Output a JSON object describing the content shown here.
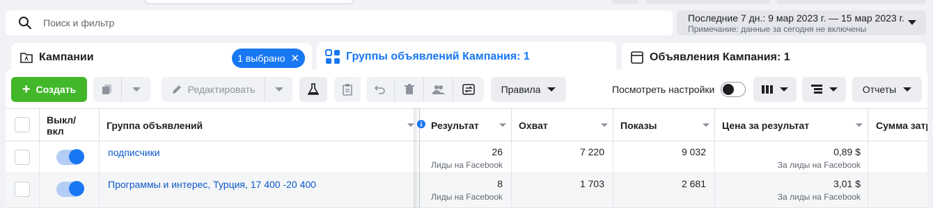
{
  "search": {
    "placeholder": "Поиск и фильтр"
  },
  "daterange": {
    "line1": "Последние 7 дн.: 9 мар 2023 г. — 15 мар 2023 г.",
    "line2": "Примечание: данные за сегодня не включены"
  },
  "tabs": {
    "campaigns": {
      "label": "Кампании",
      "badge": "1 выбрано",
      "badge_close": "✕"
    },
    "adsets": {
      "label": "Группы объявлений Кампания: 1"
    },
    "ads": {
      "label": "Объявления Кампания: 1"
    }
  },
  "toolbar": {
    "create_label": "Создать",
    "create_plus": "+",
    "edit_label": "Редактировать",
    "rules_label": "Правила",
    "view_settings_label": "Посмотреть настройки",
    "reports_label": "Отчеты"
  },
  "table": {
    "headers": {
      "onoff": "Выкл/\nвкл",
      "onoff_line1": "Выкл/",
      "onoff_line2": "вкл",
      "name": "Группа объявлений",
      "results": "Результат",
      "reach": "Охват",
      "impressions": "Показы",
      "cost": "Цена за результат",
      "spend": "Сумма затр"
    },
    "rows": [
      {
        "name": "подписчики",
        "results": "26",
        "results_sub": "Лиды на Facebook",
        "reach": "7 220",
        "impressions": "9 032",
        "cost": "0,89 $",
        "cost_sub": "За лиды на Facebook"
      },
      {
        "name": "Программы и интерес, Турция, 17 400 -20 400",
        "results": "8",
        "results_sub": "Лиды на Facebook",
        "reach": "1 703",
        "impressions": "2 681",
        "cost": "3,01 $",
        "cost_sub": "За лиды на Facebook"
      }
    ]
  },
  "colors": {
    "accent": "#1877f2",
    "create": "#42b72a",
    "link": "#0a58ca"
  }
}
